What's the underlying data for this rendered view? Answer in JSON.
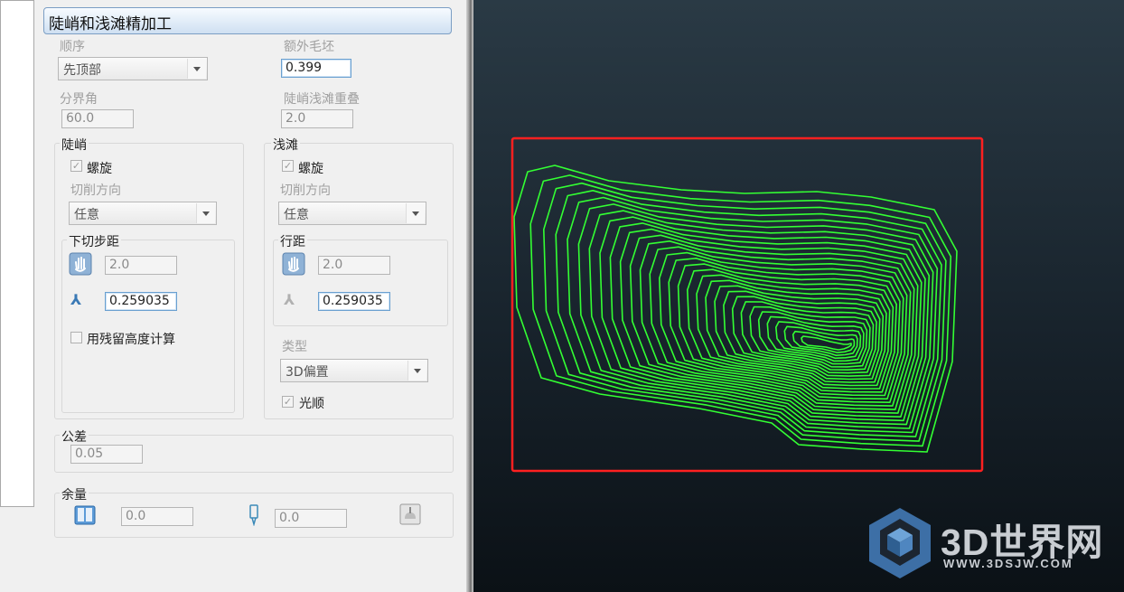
{
  "panel": {
    "title": "陡峭和浅滩精加工",
    "order_label": "顺序",
    "order_value": "先顶部",
    "extra_stock_label": "额外毛坯",
    "extra_stock_value": "0.399",
    "boundary_angle_label": "分界角",
    "boundary_angle_value": "60.0",
    "overlap_label": "陡峭浅滩重叠",
    "overlap_value": "2.0",
    "steep": {
      "label": "陡峭",
      "spiral_label": "螺旋",
      "cut_dir_label": "切削方向",
      "cut_dir_value": "任意",
      "stepdown_label": "下切步距",
      "stepdown_value": "2.0",
      "stepdown2_value": "0.259035",
      "residual_label": "用残留高度计算"
    },
    "shallow": {
      "label": "浅滩",
      "spiral_label": "螺旋",
      "cut_dir_label": "切削方向",
      "cut_dir_value": "任意",
      "stepover_label": "行距",
      "stepover_value": "2.0",
      "stepover2_value": "0.259035",
      "type_label": "类型",
      "type_value": "3D偏置",
      "smooth_label": "光顺"
    },
    "tolerance_label": "公差",
    "tolerance_value": "0.05",
    "allowance_label": "余量",
    "allowance_value1": "0.0",
    "allowance_value2": "0.0"
  },
  "watermark": {
    "brand": "3D世界网",
    "url": "WWW.3DSJW.COM"
  },
  "colors": {
    "toolpath": "#33ff33",
    "highlight_box": "#ff2020",
    "viewport_bg": "#1c2932"
  }
}
